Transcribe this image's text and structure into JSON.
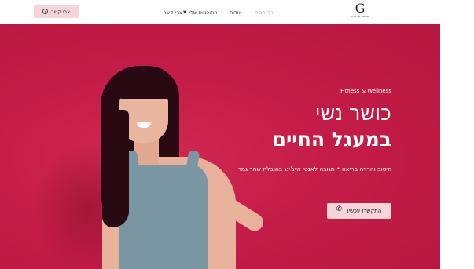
{
  "header": {
    "cta_label": "צרי קשר",
    "cta_icon": "whatsapp-icon",
    "nav": {
      "contact": "צרי קשר",
      "programs": "התוכניות שלי",
      "about": "אודות",
      "home": "דף הבית"
    },
    "logo_letter": "G",
    "logo_subtitle": "Shachar Gamer",
    "active_color": "#f29bac"
  },
  "hero": {
    "tagline": "Fitness & Wellness",
    "headline_light": "כושר נשי",
    "headline_bold": "במעגל החיים",
    "subline": "חיטוב והרזיה בריאה • תגובה לאנטי אייג'ינג בהובלת שחר גמר",
    "cta_label": "התקשרו עכשיו",
    "cta_icon": "phone-icon",
    "background_color": "#c41c48",
    "button_color": "#f7d4da"
  }
}
